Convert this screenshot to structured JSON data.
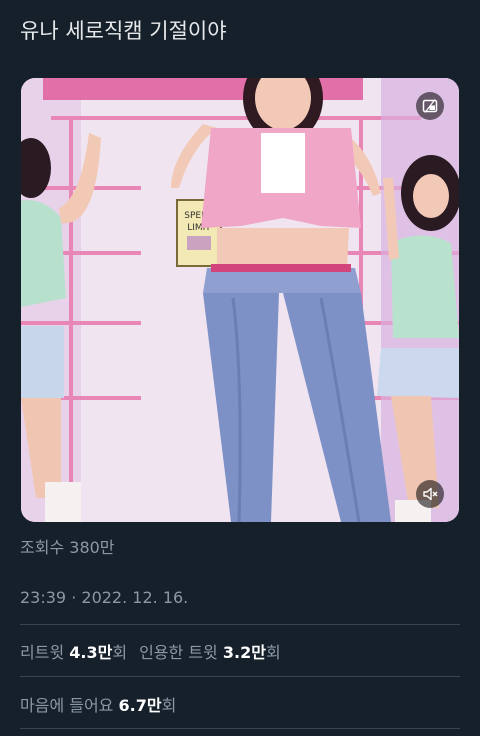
{
  "tweet": {
    "text": "유나 세로직캠 기절이야"
  },
  "media": {
    "sign_text_line1": "SPEED",
    "sign_text_line2": "LIMIT",
    "pip_icon": "picture-in-picture-icon",
    "mute_icon": "speaker-muted-icon"
  },
  "views": {
    "label": "조회수",
    "value": "380만"
  },
  "timestamp": {
    "time": "23:39",
    "separator": "·",
    "date": "2022. 12. 16."
  },
  "engagement": {
    "retweets_label": "리트윗",
    "retweets_value": "4.3만",
    "retweets_suffix": "회",
    "quotes_label": "인용한 트윗",
    "quotes_value": "3.2만",
    "quotes_suffix": "회",
    "likes_label": "마음에 들어요",
    "likes_value": "6.7만",
    "likes_suffix": "회"
  },
  "colors": {
    "background": "#15202b",
    "secondary_text": "#8b98a5",
    "primary_text": "#ffffff",
    "divider": "#38444d"
  }
}
